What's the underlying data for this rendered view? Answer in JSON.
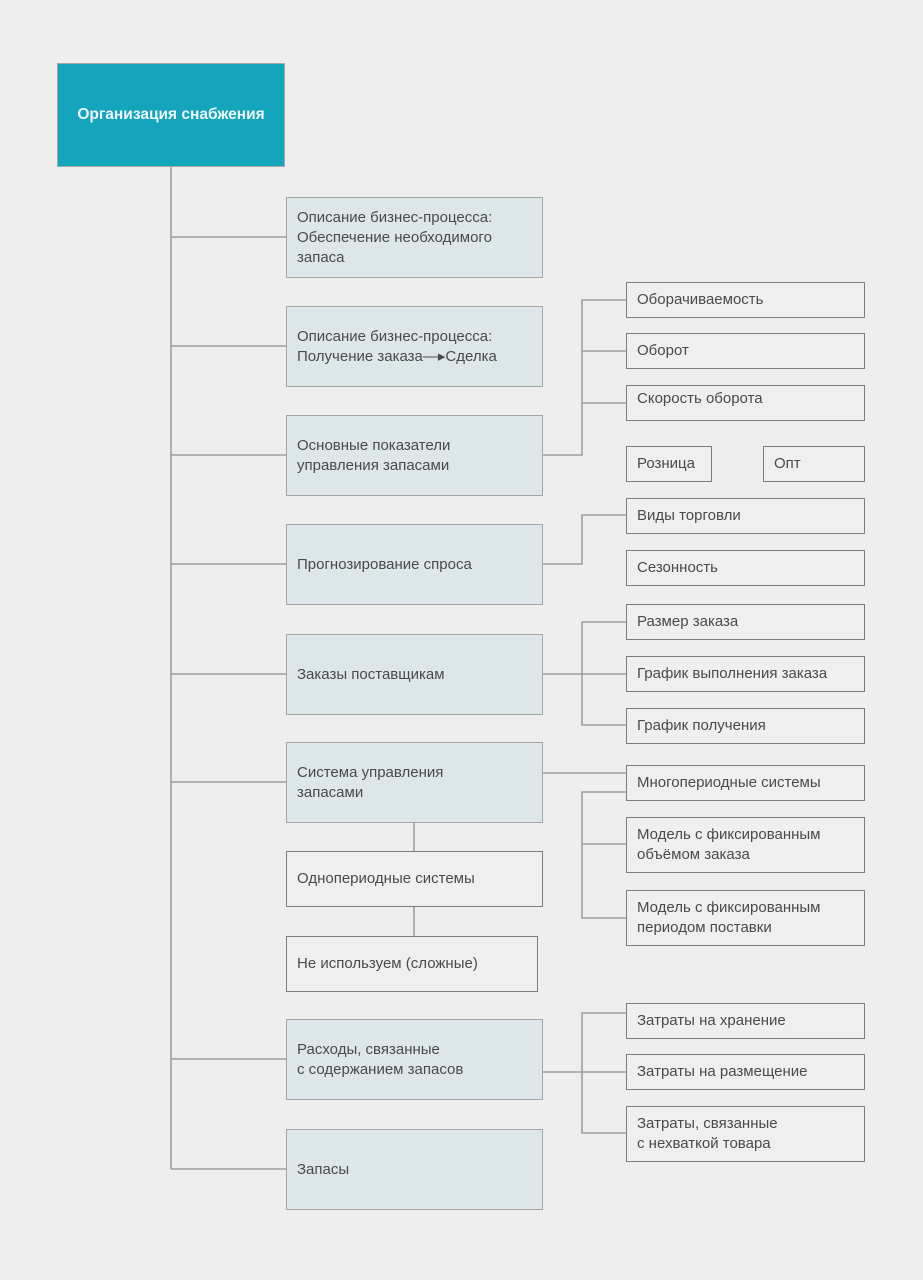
{
  "diagram": {
    "root": "Организация снабжения",
    "branches": [
      {
        "label": "Описание бизнес-процесса:\nОбеспечение необходимого\nзапаса",
        "children": []
      },
      {
        "label": "Описание бизнес-процесса:\nПолучение заказа—▸Сделка",
        "children": []
      },
      {
        "label": "Основные показатели\nуправления запасами",
        "children": [
          "Оборачиваемость",
          "Оборот",
          "Скорость оборота"
        ]
      },
      {
        "label": "Прогнозирование спроса",
        "children": [
          "Виды торговли"
        ],
        "sub_children": [
          "Розница",
          "Опт"
        ],
        "extra": [
          "Сезонность"
        ]
      },
      {
        "label": "Заказы поставщикам",
        "children": [
          "Размер заказа",
          "График выполнения заказа",
          "График получения"
        ]
      },
      {
        "label": "Система управления\nзапасами",
        "down_chain": [
          "Однопериодные системы",
          "Не используем (сложные)"
        ],
        "right": "Многопериодные системы",
        "right_children": [
          "Модель с фиксированным\nобъёмом заказа",
          "Модель с фиксированным\nпериодом поставки"
        ]
      },
      {
        "label": "Расходы, связанные\nс содержанием запасов",
        "children": [
          "Затраты на хранение",
          "Затраты на размещение",
          "Затраты, связанные\nс нехваткой товара"
        ]
      },
      {
        "label": "Запасы",
        "children": []
      }
    ]
  },
  "colors": {
    "root": "#14a5bd",
    "main_box": "#dde7e9",
    "background": "#eeeeee",
    "line": "#8f8f8f"
  }
}
